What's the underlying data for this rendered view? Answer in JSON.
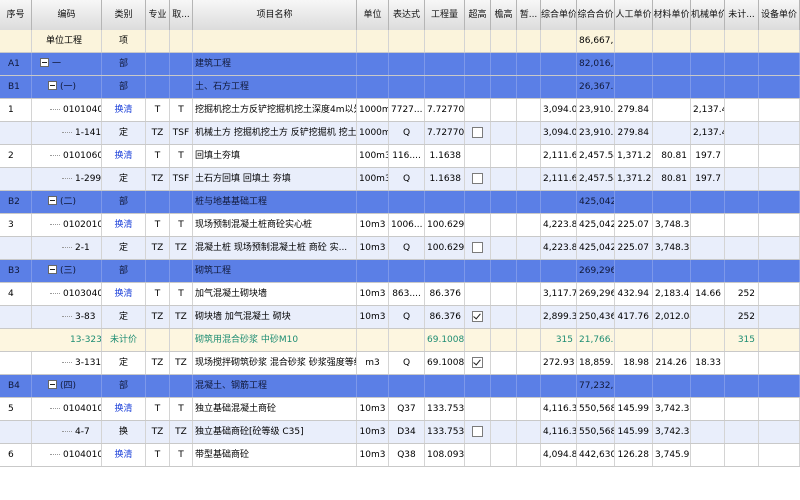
{
  "columns": [
    "序号",
    "编码",
    "类别",
    "专业",
    "取...",
    "项目名称",
    "单位",
    "表达式",
    "工程量",
    "超高",
    "檐高",
    "暂...",
    "综合单价",
    "综合合价",
    "人工单价",
    "材料单价",
    "机械单价",
    "未计...",
    "设备单价"
  ],
  "rows": [
    {
      "style": "top",
      "seq": "",
      "code": "单位工程",
      "type": "项",
      "pro": "",
      "qu": "",
      "name": "",
      "unit": "",
      "expr": "",
      "qty": "",
      "chk": "",
      "zh_price": "",
      "zh_total": "86,667,...",
      "labor": "",
      "mat": "",
      "mach": "",
      "wj": "",
      "equip": ""
    },
    {
      "style": "header",
      "seq": "A1",
      "code": "一",
      "type": "部",
      "pro": "",
      "qu": "",
      "name": "建筑工程",
      "unit": "",
      "expr": "",
      "qty": "",
      "chk": "",
      "zh_price": "",
      "zh_total": "82,016,...",
      "labor": "",
      "mat": "",
      "mach": "",
      "wj": "",
      "equip": ""
    },
    {
      "style": "header",
      "seq": "B1",
      "code": "(一)",
      "type": "部",
      "pro": "",
      "qu": "",
      "name": "土、石方工程",
      "unit": "",
      "expr": "",
      "qty": "",
      "chk": "",
      "zh_price": "",
      "zh_total": "26,367.69",
      "labor": "",
      "mat": "",
      "mach": "",
      "wj": "",
      "equip": ""
    },
    {
      "style": "norm",
      "seq": "1",
      "code": "0101040...",
      "type": "换清",
      "pro": "T",
      "qu": "T",
      "name": "挖掘机挖土方反铲挖掘机挖土深度4m以外",
      "unit": "1000m3",
      "expr": "7727...",
      "qty": "7.727709",
      "chk": "",
      "zh_price": "3,094.08",
      "zh_total": "23,910.15",
      "labor": "279.84",
      "mat": "",
      "mach": "2,137.41",
      "wj": "",
      "equip": ""
    },
    {
      "style": "alt",
      "seq": "",
      "code": "1-141",
      "type": "定",
      "pro": "TZ",
      "qu": "TSF",
      "name": "机械土方 挖掘机挖土方 反铲挖掘机 挖土深...",
      "unit": "1000m3",
      "expr": "Q",
      "qty": "7.727709",
      "chk": "off",
      "zh_price": "3,094.08",
      "zh_total": "23,910.15",
      "labor": "279.84",
      "mat": "",
      "mach": "2,137.41",
      "wj": "",
      "equip": ""
    },
    {
      "style": "norm",
      "seq": "2",
      "code": "0101060...",
      "type": "换清",
      "pro": "T",
      "qu": "T",
      "name": "回填土夯填",
      "unit": "100m3",
      "expr": "116....",
      "qty": "1.1638",
      "chk": "",
      "zh_price": "2,111.65",
      "zh_total": "2,457.54",
      "labor": "1,371.22",
      "mat": "80.81",
      "mach": "197.7",
      "wj": "",
      "equip": ""
    },
    {
      "style": "alt",
      "seq": "",
      "code": "1-299",
      "type": "定",
      "pro": "TZ",
      "qu": "TSF",
      "name": "土石方回填 回填土 夯填",
      "unit": "100m3",
      "expr": "Q",
      "qty": "1.1638",
      "chk": "off",
      "zh_price": "2,111.65",
      "zh_total": "2,457.54",
      "labor": "1,371.22",
      "mat": "80.81",
      "mach": "197.7",
      "wj": "",
      "equip": ""
    },
    {
      "style": "header",
      "seq": "B2",
      "code": "(二)",
      "type": "部",
      "pro": "",
      "qu": "",
      "name": "桩与地基基础工程",
      "unit": "",
      "expr": "",
      "qty": "",
      "chk": "",
      "zh_price": "",
      "zh_total": "425,042.4",
      "labor": "",
      "mat": "",
      "mach": "",
      "wj": "",
      "equip": ""
    },
    {
      "style": "norm",
      "seq": "3",
      "code": "0102010...",
      "type": "换清",
      "pro": "T",
      "qu": "T",
      "name": "现场预制混凝土桩商砼实心桩",
      "unit": "10m3",
      "expr": "1006...",
      "qty": "100.62938",
      "chk": "",
      "zh_price": "4,223.84",
      "zh_total": "425,042.4",
      "labor": "225.07",
      "mat": "3,748.33",
      "mach": "",
      "wj": "",
      "equip": ""
    },
    {
      "style": "alt",
      "seq": "",
      "code": "2-1",
      "type": "定",
      "pro": "TZ",
      "qu": "TZ",
      "name": "混凝土桩 现场预制混凝土桩 商砼 实...",
      "unit": "10m3",
      "expr": "Q",
      "qty": "100.62938",
      "chk": "off",
      "zh_price": "4,223.84",
      "zh_total": "425,042.4",
      "labor": "225.07",
      "mat": "3,748.33",
      "mach": "",
      "wj": "",
      "equip": ""
    },
    {
      "style": "header",
      "seq": "B3",
      "code": "(三)",
      "type": "部",
      "pro": "",
      "qu": "",
      "name": "砌筑工程",
      "unit": "",
      "expr": "",
      "qty": "",
      "chk": "",
      "zh_price": "",
      "zh_total": "269,296.18",
      "labor": "",
      "mat": "",
      "mach": "",
      "wj": "",
      "equip": ""
    },
    {
      "style": "norm",
      "seq": "4",
      "code": "0103040...",
      "type": "换清",
      "pro": "T",
      "qu": "T",
      "name": "加气混凝土砌块墙",
      "unit": "10m3",
      "expr": "863....",
      "qty": "86.376",
      "chk": "",
      "zh_price": "3,117.72",
      "zh_total": "269,296.18",
      "labor": "432.94",
      "mat": "2,183.45",
      "mach": "14.66",
      "wj": "252",
      "equip": ""
    },
    {
      "style": "alt",
      "seq": "",
      "code": "3-83",
      "type": "定",
      "pro": "TZ",
      "qu": "TZ",
      "name": "砌块墙 加气混凝土 砌块",
      "unit": "10m3",
      "expr": "Q",
      "qty": "86.376",
      "chk": "on",
      "zh_price": "2,899.38",
      "zh_total": "250,436.85",
      "labor": "417.76",
      "mat": "2,012.04",
      "mach": "",
      "wj": "252",
      "equip": ""
    },
    {
      "style": "unit",
      "seq": "13-323",
      "code": "",
      "type": "未计价",
      "pro": "",
      "qu": "",
      "name": "砌筑用混合砂浆 中砂M10",
      "unit": "",
      "expr": "",
      "qty": "69.1008",
      "chk": "",
      "zh_price": "315",
      "zh_total": "21,766.75",
      "labor": "",
      "mat": "",
      "mach": "",
      "wj": "315",
      "equip": ""
    },
    {
      "style": "norm",
      "seq": "",
      "code": "3-131",
      "type": "定",
      "pro": "TZ",
      "qu": "TZ",
      "name": "现场搅拌砌筑砂浆 混合砂浆 砂浆强度等级 M10",
      "unit": "m3",
      "expr": "Q",
      "qty": "69.1008",
      "chk": "on",
      "zh_price": "272.93",
      "zh_total": "18,859.68",
      "labor": "18.98",
      "mat": "214.26",
      "mach": "18.33",
      "wj": "",
      "equip": ""
    },
    {
      "style": "header",
      "seq": "B4",
      "code": "(四)",
      "type": "部",
      "pro": "",
      "qu": "",
      "name": "混凝土、钢筋工程",
      "unit": "",
      "expr": "",
      "qty": "",
      "chk": "",
      "zh_price": "",
      "zh_total": "77,232,...",
      "labor": "",
      "mat": "",
      "mach": "",
      "wj": "",
      "equip": ""
    },
    {
      "style": "norm",
      "seq": "5",
      "code": "0104010...",
      "type": "换清",
      "pro": "T",
      "qu": "T",
      "name": "独立基础混凝土商砼",
      "unit": "10m3",
      "expr": "Q37",
      "qty": "133.753021",
      "chk": "",
      "zh_price": "4,116.31",
      "zh_total": "550,568.9",
      "labor": "145.99",
      "mat": "3,742.33",
      "mach": "",
      "wj": "",
      "equip": ""
    },
    {
      "style": "alt",
      "seq": "",
      "code": "4-7",
      "type": "换",
      "pro": "TZ",
      "qu": "TZ",
      "name": "独立基础商砼[砼等级 C35]",
      "unit": "10m3",
      "expr": "D34",
      "qty": "133.753021",
      "chk": "off",
      "zh_price": "4,116.31",
      "zh_total": "550,568.9",
      "labor": "145.99",
      "mat": "3,742.33",
      "mach": "",
      "wj": "",
      "equip": ""
    },
    {
      "style": "norm",
      "seq": "6",
      "code": "0104010...",
      "type": "换清",
      "pro": "T",
      "qu": "T",
      "name": "带型基础商砼",
      "unit": "10m3",
      "expr": "Q38",
      "qty": "108.093854",
      "chk": "",
      "zh_price": "4,094.87",
      "zh_total": "442,630.28",
      "labor": "126.28",
      "mat": "3,745.93",
      "mach": "",
      "wj": "",
      "equip": ""
    }
  ]
}
